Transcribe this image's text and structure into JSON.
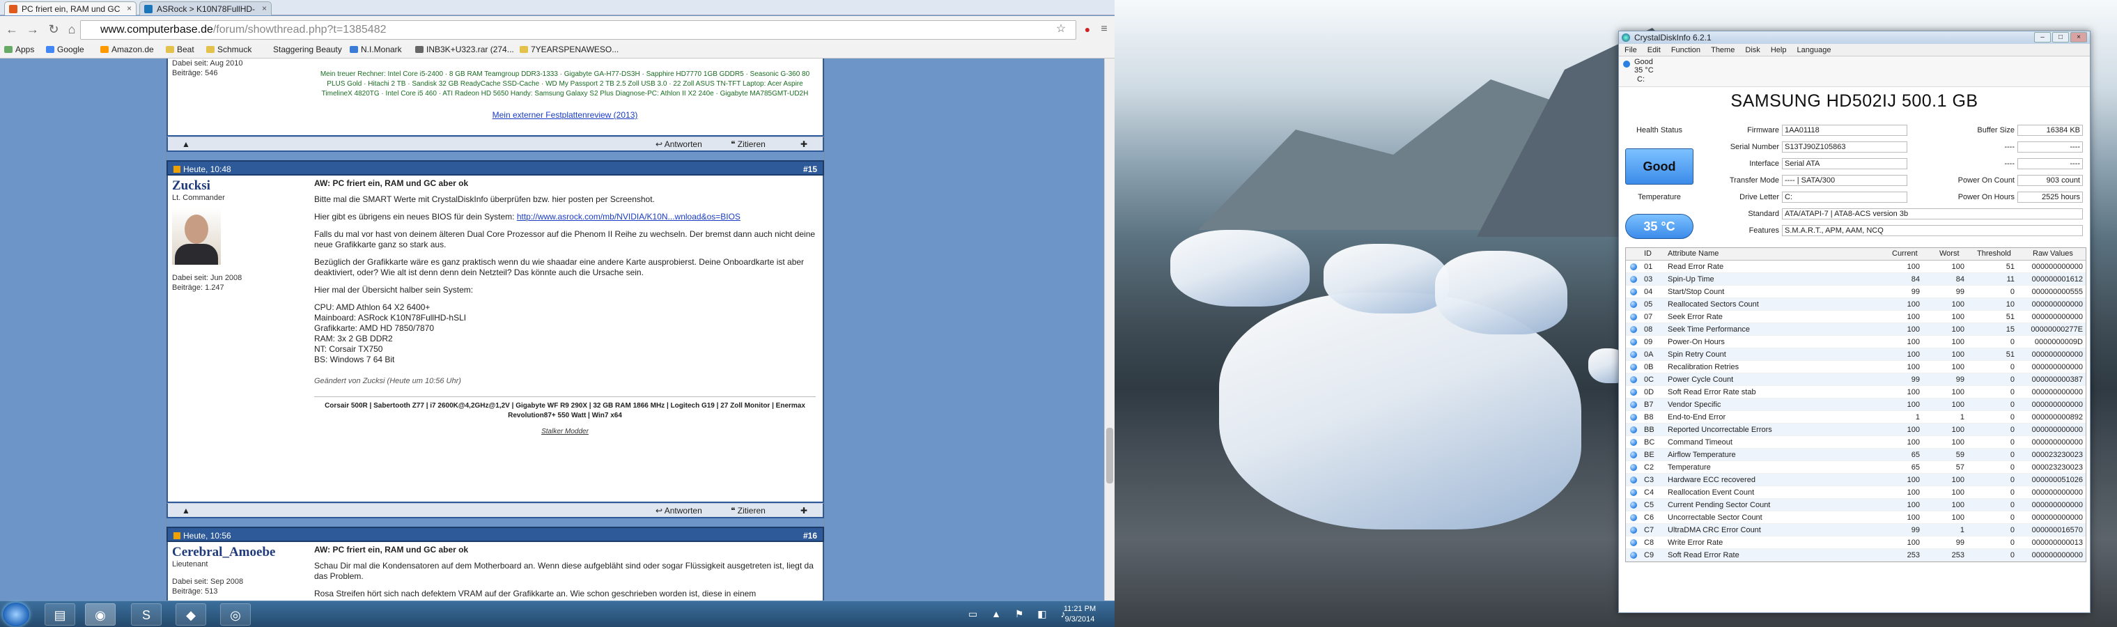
{
  "browser": {
    "tabs": [
      {
        "title": "PC friert ein, RAM und GC"
      },
      {
        "title": "ASRock > K10N78FullHD-"
      }
    ],
    "url_host": "www.computerbase.de",
    "url_path": "/forum/showthread.php?t=1385482",
    "bookmarks": [
      "Apps",
      "Google",
      "Amazon.de",
      "Beat",
      "Schmuck",
      "Staggering Beauty",
      "N.I.Monark",
      "INB3K+U323.rar (274...",
      "7YEARSPENAWESO..."
    ]
  },
  "forum": {
    "top_post": {
      "meta": "Dabei seit: Aug 2010",
      "posts": "Beiträge: 546",
      "sig_text": "Mein treuer Rechner: Intel Core i5-2400 · 8 GB RAM Teamgroup DDR3-1333 · Gigabyte GA-H77-DS3H · Sapphire HD7770 1GB GDDR5 · Seasonic G-360 80 PLUS Gold · Hitachi 2 TB · Sandisk 32 GB ReadyCache SSD-Cache · WD My Passport 2 TB 2.5 Zoll USB 3.0 · 22 Zoll ASUS TN-TFT Laptop: Acer Aspire TimelineX 4820TG · Intel Core i5 460 · ATI Radeon HD 5650 Handy: Samsung Galaxy S2 Plus Diagnose-PC: Athlon II X2 240e · Gigabyte MA785GMT-UD2H",
      "sig_link": "Mein externer Festplattenreview (2013)"
    },
    "actions": {
      "reply": "Antworten",
      "quote": "Zitieren"
    },
    "post15": {
      "time": "Heute, 10:48",
      "num": "#15",
      "user": "Zucksi",
      "rank": "Lt. Commander",
      "since": "Dabei seit: Jun 2008",
      "posts": "Beiträge: 1.247",
      "title": "AW: PC friert ein, RAM und GC aber ok",
      "p1": "Bitte mal die SMART Werte mit CrystalDiskInfo überprüfen bzw. hier posten per Screenshot.",
      "p2_prefix": "Hier gibt es übrigens ein neues BIOS für dein System: ",
      "p2_link": "http://www.asrock.com/mb/NVIDIA/K10N...wnload&os=BIOS",
      "p3": "Falls du mal vor hast von deinem älteren Dual Core Prozessor auf die Phenom II Reihe zu wechseln. Der bremst dann auch nicht deine neue Grafikkarte ganz so stark aus.",
      "p4": "Bezüglich der Grafikkarte wäre es ganz praktisch wenn du wie shaadar eine andere Karte ausprobierst. Deine Onboardkarte ist aber deaktiviert, oder? Wie alt ist denn denn dein Netzteil? Das könnte auch die Ursache sein.",
      "p5": "Hier mal der Übersicht halber sein System:",
      "specs": [
        "CPU: AMD Athlon 64 X2 6400+",
        "Mainboard: ASRock K10N78FullHD-hSLI",
        "Grafikkarte: AMD HD 7850/7870",
        "RAM: 3x 2 GB DDR2",
        "NT: Corsair TX750",
        "BS: Windows 7 64 Bit"
      ],
      "edited": "Geändert von Zucksi (Heute um 10:56 Uhr)",
      "sig": "Corsair 500R | Sabertooth Z77 | i7 2600K@4,2GHz@1,2V | Gigabyte WF R9 290X | 32 GB RAM 1866 MHz | Logitech G19 | 27 Zoll Monitor | Enermax Revolution87+ 550 Watt | Win7 x64",
      "sig2": "Stalker Modder"
    },
    "post16": {
      "time": "Heute, 10:56",
      "num": "#16",
      "user": "Cerebral_Amoebe",
      "rank": "Lieutenant",
      "since": "Dabei seit: Sep 2008",
      "posts": "Beiträge: 513",
      "title": "AW: PC friert ein, RAM und GC aber ok",
      "p1": "Schau Dir mal die Kondensatoren auf dem Motherboard an. Wenn diese aufgebläht sind oder sogar Flüssigkeit ausgetreten ist, liegt da das Problem.",
      "p2": "Rosa Streifen hört sich nach defektem VRAM auf der Grafikkarte an. Wie schon geschrieben worden ist, diese in einem"
    }
  },
  "taskbar": {
    "time": "11:21 PM",
    "date": "9/3/2014"
  },
  "cdi": {
    "title": "CrystalDiskInfo 6.2.1",
    "menu": [
      "File",
      "Edit",
      "Function",
      "Theme",
      "Disk",
      "Help",
      "Language"
    ],
    "drive_status": "Good",
    "drive_temp": "35 °C",
    "drive_letter": "C:",
    "model": "SAMSUNG HD502IJ 500.1 GB",
    "labels": {
      "health": "Health Status",
      "temperature": "Temperature",
      "firmware": "Firmware",
      "serial": "Serial Number",
      "interface": "Interface",
      "transfer": "Transfer Mode",
      "drive_letter": "Drive Letter",
      "standard": "Standard",
      "features": "Features",
      "buffer": "Buffer Size",
      "power_count": "Power On Count",
      "power_hours": "Power On Hours"
    },
    "health": "Good",
    "temperature": "35 °C",
    "firmware": "1AA01118",
    "serial": "S13TJ90Z105863",
    "interface": "Serial ATA",
    "transfer": "---- | SATA/300",
    "drive_letter_val": "C:",
    "standard": "ATA/ATAPI-7 | ATA8-ACS version 3b",
    "features": "S.M.A.R.T., APM, AAM, NCQ",
    "buffer": "16384 KB",
    "blank1": "----",
    "blank2": "----",
    "blank1v": "----",
    "blank2v": "----",
    "power_count": "903 count",
    "power_hours": "2525 hours",
    "columns": {
      "id": "ID",
      "name": "Attribute Name",
      "current": "Current",
      "worst": "Worst",
      "threshold": "Threshold",
      "raw": "Raw Values"
    },
    "attributes": [
      [
        "01",
        "Read Error Rate",
        "100",
        "100",
        "51",
        "000000000000"
      ],
      [
        "03",
        "Spin-Up Time",
        "84",
        "84",
        "11",
        "000000001612"
      ],
      [
        "04",
        "Start/Stop Count",
        "99",
        "99",
        "0",
        "000000000555"
      ],
      [
        "05",
        "Reallocated Sectors Count",
        "100",
        "100",
        "10",
        "000000000000"
      ],
      [
        "07",
        "Seek Error Rate",
        "100",
        "100",
        "51",
        "000000000000"
      ],
      [
        "08",
        "Seek Time Performance",
        "100",
        "100",
        "15",
        "00000000277E"
      ],
      [
        "09",
        "Power-On Hours",
        "100",
        "100",
        "0",
        "0000000009D"
      ],
      [
        "0A",
        "Spin Retry Count",
        "100",
        "100",
        "51",
        "000000000000"
      ],
      [
        "0B",
        "Recalibration Retries",
        "100",
        "100",
        "0",
        "000000000000"
      ],
      [
        "0C",
        "Power Cycle Count",
        "99",
        "99",
        "0",
        "000000000387"
      ],
      [
        "0D",
        "Soft Read Error Rate stab",
        "100",
        "100",
        "0",
        "000000000000"
      ],
      [
        "B7",
        "Vendor Specific",
        "100",
        "100",
        "0",
        "000000000000"
      ],
      [
        "B8",
        "End-to-End Error",
        "1",
        "1",
        "0",
        "000000000892"
      ],
      [
        "BB",
        "Reported Uncorrectable Errors",
        "100",
        "100",
        "0",
        "000000000000"
      ],
      [
        "BC",
        "Command Timeout",
        "100",
        "100",
        "0",
        "000000000000"
      ],
      [
        "BE",
        "Airflow Temperature",
        "65",
        "59",
        "0",
        "000023230023"
      ],
      [
        "C2",
        "Temperature",
        "65",
        "57",
        "0",
        "000023230023"
      ],
      [
        "C3",
        "Hardware ECC recovered",
        "100",
        "100",
        "0",
        "000000051026"
      ],
      [
        "C4",
        "Reallocation Event Count",
        "100",
        "100",
        "0",
        "000000000000"
      ],
      [
        "C5",
        "Current Pending Sector Count",
        "100",
        "100",
        "0",
        "000000000000"
      ],
      [
        "C6",
        "Uncorrectable Sector Count",
        "100",
        "100",
        "0",
        "000000000000"
      ],
      [
        "C7",
        "UltraDMA CRC Error Count",
        "99",
        "1",
        "0",
        "000000016570"
      ],
      [
        "C8",
        "Write Error Rate",
        "100",
        "99",
        "0",
        "000000000013"
      ],
      [
        "C9",
        "Soft Read Error Rate",
        "253",
        "253",
        "0",
        "000000000000"
      ]
    ]
  }
}
